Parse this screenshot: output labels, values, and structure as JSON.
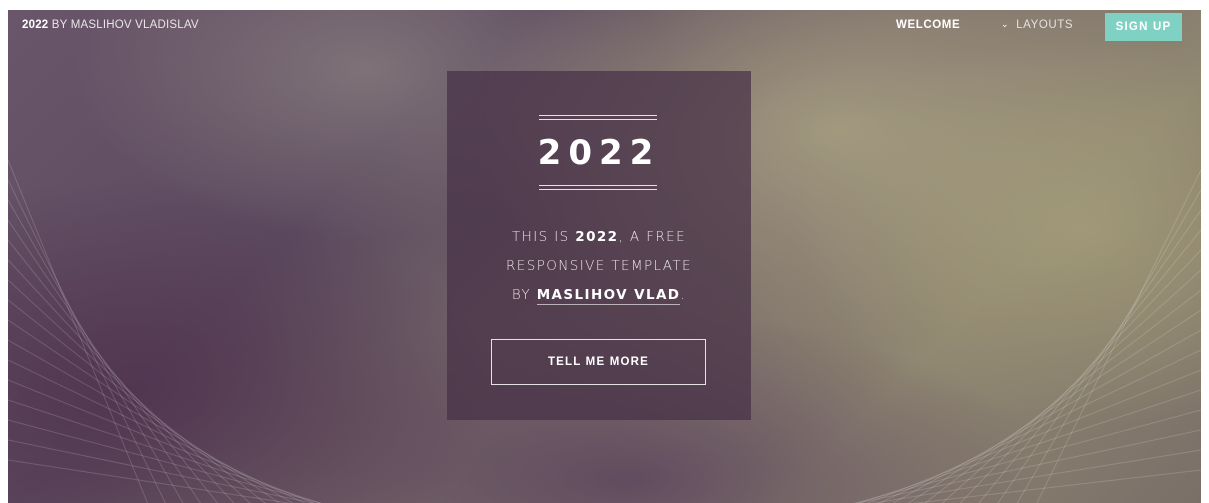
{
  "nav": {
    "brand_bold": "2022",
    "brand_rest": " BY MASLIHOV VLADISLAV",
    "welcome": "WELCOME",
    "layouts": "LAYOUTS",
    "layouts_icon": "chevron-down-icon",
    "signup": "SIGN UP"
  },
  "hero": {
    "title": "2022",
    "line1_prefix": "THIS IS ",
    "line1_bold": "2022",
    "line1_suffix": ", A FREE",
    "line2": "RESPONSIVE TEMPLATE",
    "line3_prefix": "BY ",
    "line3_link": "MASLIHOV VLAD",
    "line3_suffix": ".",
    "button": "TELL ME MORE"
  },
  "colors": {
    "signup_bg": "#7fd1c4",
    "card_bg": "rgba(70,48,70,0.72)",
    "text": "#ffffff"
  }
}
